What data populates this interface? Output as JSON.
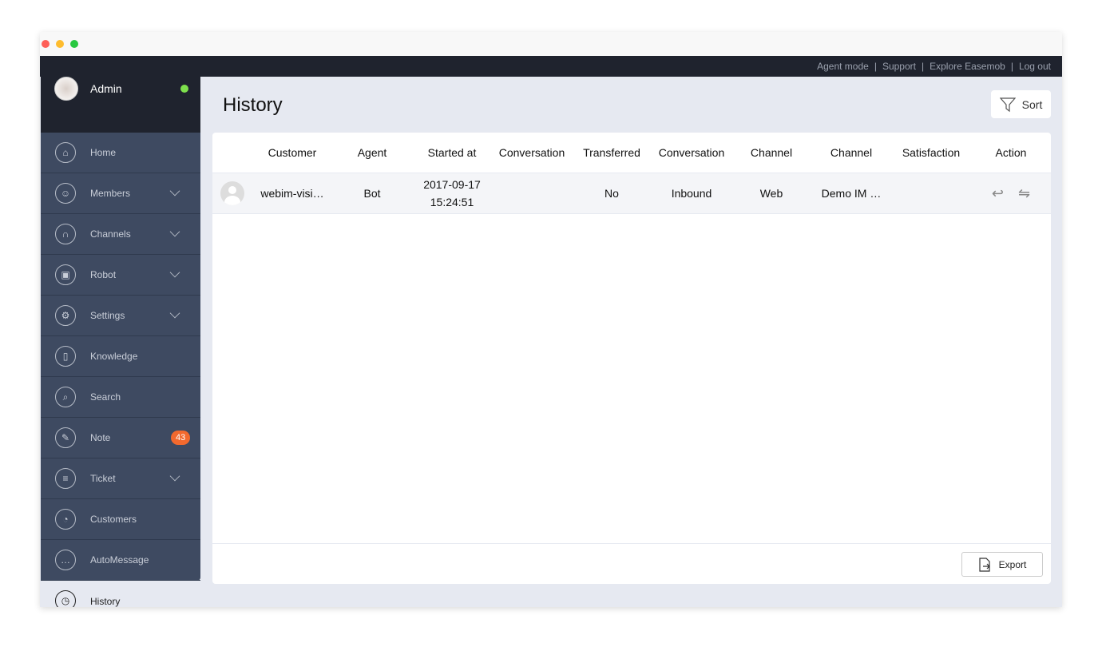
{
  "topbar": {
    "links": [
      "Agent mode",
      "Support",
      "Explore Easemob",
      "Log out"
    ]
  },
  "user": {
    "name": "Admin",
    "status": "online",
    "status_color": "#7ee04d"
  },
  "sidebar": {
    "items": [
      {
        "label": "Home",
        "icon": "home-icon",
        "chevron": false
      },
      {
        "label": "Members",
        "icon": "members-icon",
        "chevron": true
      },
      {
        "label": "Channels",
        "icon": "channels-icon",
        "chevron": true
      },
      {
        "label": "Robot",
        "icon": "robot-icon",
        "chevron": true
      },
      {
        "label": "Settings",
        "icon": "gear-icon",
        "chevron": true
      },
      {
        "label": "Knowledge",
        "icon": "book-icon",
        "chevron": false
      },
      {
        "label": "Search",
        "icon": "search-icon",
        "chevron": false
      },
      {
        "label": "Note",
        "icon": "note-icon",
        "chevron": false,
        "badge": "43"
      },
      {
        "label": "Ticket",
        "icon": "ticket-icon",
        "chevron": true
      },
      {
        "label": "Customers",
        "icon": "customers-icon",
        "chevron": false
      },
      {
        "label": "AutoMessage",
        "icon": "message-icon",
        "chevron": false
      },
      {
        "label": "History",
        "icon": "clock-icon",
        "chevron": false,
        "active": true
      }
    ]
  },
  "main": {
    "title": "History",
    "sort_label": "Sort",
    "export_label": "Export",
    "columns": [
      "Customer",
      "Agent",
      "Started at",
      "Conversation",
      "Transferred",
      "Conversation",
      "Channel",
      "Channel",
      "Satisfaction",
      "Action"
    ],
    "rows": [
      {
        "customer": "webim-visi…",
        "agent": "Bot",
        "started_date": "2017-09-17",
        "started_time": "15:24:51",
        "conversation": "",
        "transferred": "No",
        "direction": "Inbound",
        "channel": "Web",
        "channel_name": "Demo IM …",
        "satisfaction": ""
      }
    ]
  },
  "colors": {
    "accent_badge": "#f2692e",
    "sidebar": "#3e4a61",
    "topbar": "#1f232e"
  }
}
